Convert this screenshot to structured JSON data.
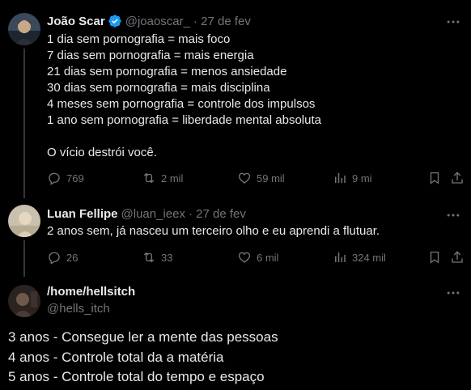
{
  "posts": [
    {
      "author_name": "João Scar",
      "handle": "@joaoscar_",
      "date": "· 27 de fev",
      "text": "1 dia sem pornografia = mais foco\n7 dias sem pornografia = mais energia\n21 dias sem pornografia = menos ansiedade\n30 dias sem pornografia =  mais disciplina\n4 meses sem pornografia = controle dos impulsos\n1 ano sem pornografia = liberdade mental absoluta\n\nO vício destrói você.",
      "replies": "769",
      "reposts": "2 mil",
      "likes": "59 mil",
      "views": "9 mi"
    },
    {
      "author_name": "Luan Fellipe",
      "handle": "@luan_ieex",
      "date": "· 27 de fev",
      "text": "2 anos sem, já nasceu um terceiro olho e eu aprendi a flutuar.",
      "replies": "26",
      "reposts": "33",
      "likes": "6 mil",
      "views": "324 mil"
    },
    {
      "author_name": "/home/hellsitch",
      "handle": "@hells_itch",
      "text": "3 anos - Consegue ler a mente das pessoas\n4 anos - Controle total da a matéria\n5 anos - Controle total do tempo e espaço"
    }
  ],
  "colors": {
    "background": "#000000",
    "text": "#e7e9ea",
    "muted": "#71767b",
    "verified": "#1d9bf0"
  },
  "icons": [
    "verified-badge-icon",
    "more-icon",
    "reply-icon",
    "repost-icon",
    "like-icon",
    "views-icon",
    "bookmark-icon",
    "share-icon"
  ]
}
